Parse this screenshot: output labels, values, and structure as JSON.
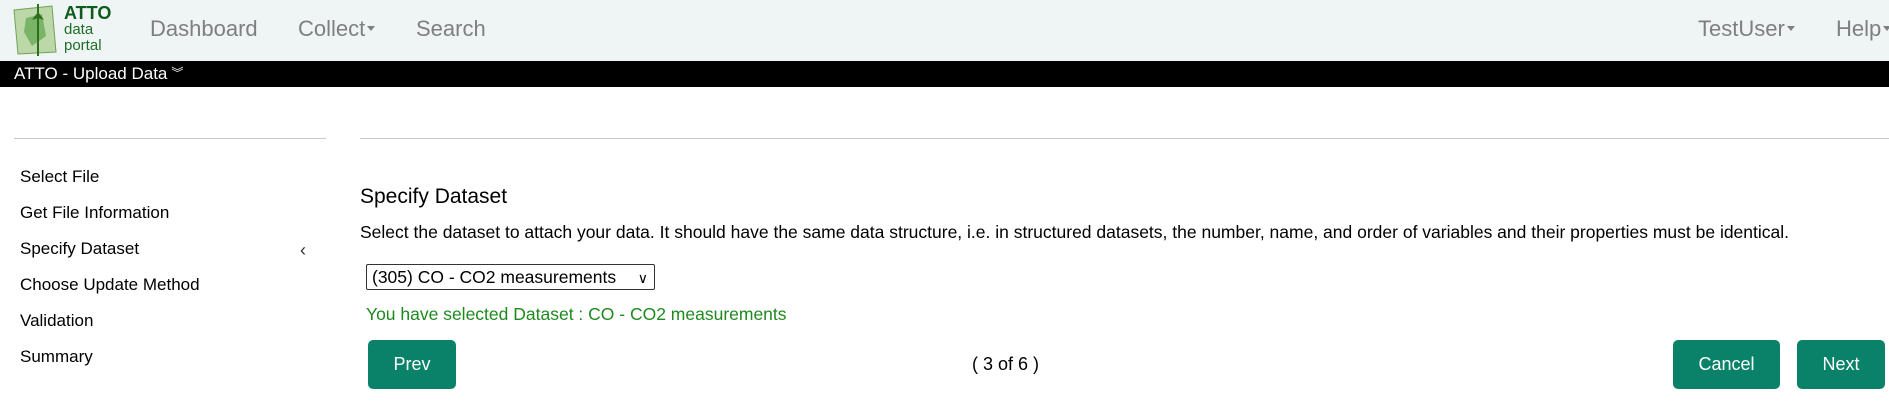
{
  "logo": {
    "line1": "ATTO",
    "line2": "data",
    "line3": "portal"
  },
  "nav": {
    "dashboard": "Dashboard",
    "collect": "Collect",
    "search": "Search",
    "user": "TestUser",
    "help": "Help"
  },
  "titlebar": {
    "title": "ATTO - Upload Data"
  },
  "sidebar": {
    "items": [
      {
        "label": "Select File"
      },
      {
        "label": "Get File Information"
      },
      {
        "label": "Specify Dataset"
      },
      {
        "label": "Choose Update Method"
      },
      {
        "label": "Validation"
      },
      {
        "label": "Summary"
      }
    ]
  },
  "main": {
    "title": "Specify Dataset",
    "description": "Select the dataset to attach your data. It should have the same data structure, i.e. in structured datasets, the number, name, and order of variables and their properties must be identical.",
    "select_value": "(305) CO - CO2 measurements",
    "selected_message": "You have selected Dataset : CO - CO2 measurements"
  },
  "footer": {
    "prev_label": "Prev",
    "step": "( 3 of 6 )",
    "cancel_label": "Cancel",
    "next_label": "Next"
  },
  "colors": {
    "accent": "#0a826a",
    "success_text": "#1e8a1e",
    "nav_bg": "#eef5f4"
  }
}
